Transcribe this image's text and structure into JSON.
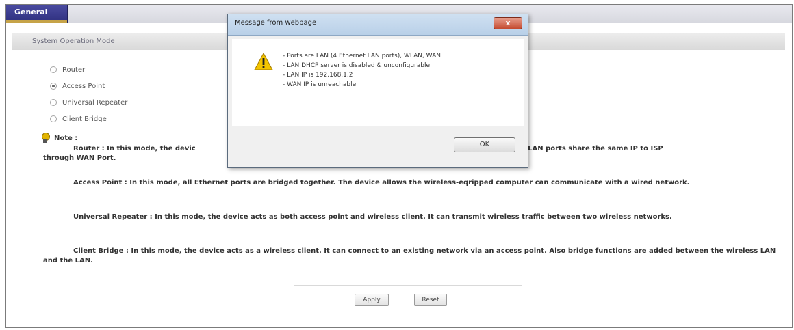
{
  "tabs": {
    "general": "General"
  },
  "section": {
    "title": "System Operation Mode"
  },
  "modes": [
    {
      "label": "Router",
      "selected": false
    },
    {
      "label": "Access Point",
      "selected": true
    },
    {
      "label": "Universal Repeater",
      "selected": false
    },
    {
      "label": "Client Bridge",
      "selected": false
    }
  ],
  "note": {
    "label": "Note :",
    "router_pre": "Router : In this mode, the devic",
    "router_post": ". PCs in LAN ports share the same IP to ISP",
    "router_line2": "through WAN Port.",
    "access_point": "Access Point : In this mode, all Ethernet ports are bridged together. The device allows the wireless-eqripped computer can communicate with a wired network.",
    "universal_repeater": "Universal Repeater : In this mode, the device acts as both access point and wireless client. It can transmit wireless traffic between two wireless networks.",
    "client_bridge": "Client Bridge : In this mode, the device acts as a wireless client. It can connect to an existing network via an access point. Also bridge functions are added between the wireless LAN and the LAN."
  },
  "buttons": {
    "apply": "Apply",
    "reset": "Reset"
  },
  "dialog": {
    "title": "Message from webpage",
    "close": "x",
    "lines": [
      "- Ports are LAN (4 Ethernet LAN ports), WLAN, WAN",
      "- LAN DHCP server is disabled & unconfigurable",
      "- LAN IP is 192.168.1.2",
      "- WAN IP is unreachable"
    ],
    "ok": "OK"
  }
}
